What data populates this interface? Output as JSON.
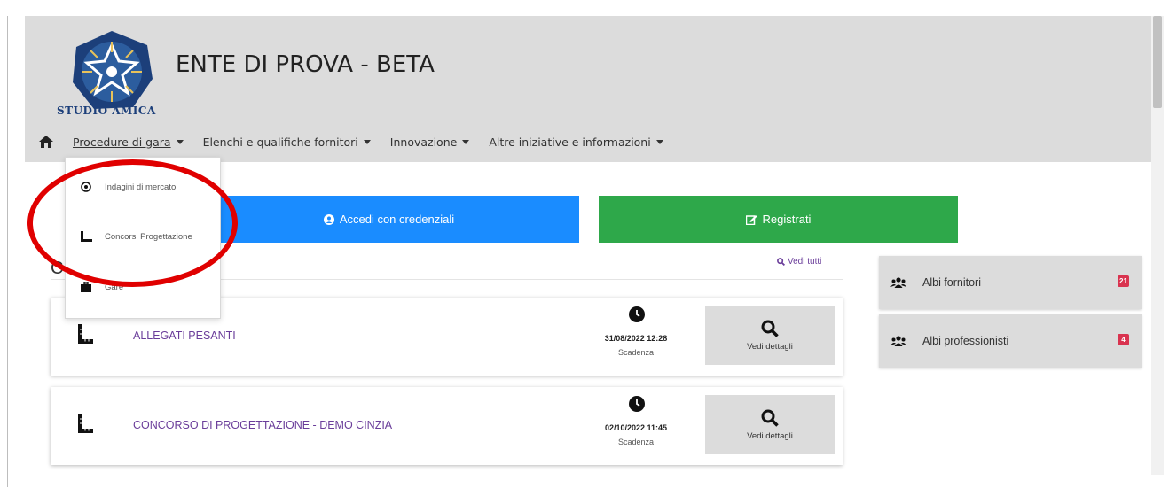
{
  "header": {
    "logo_text": "STUDIO AMICA",
    "site_title": "ENTE DI PROVA - BETA"
  },
  "nav": {
    "items": [
      {
        "label": "Procedure di gara"
      },
      {
        "label": "Elenchi e qualifiche fornitori"
      },
      {
        "label": "Innovazione"
      },
      {
        "label": "Altre iniziative e informazioni"
      }
    ]
  },
  "dropdown": {
    "items": [
      {
        "label": "Indagini di mercato",
        "icon": "target-icon"
      },
      {
        "label": "Concorsi Progettazione",
        "icon": "ruler-icon"
      },
      {
        "label": "Gare",
        "icon": "briefcase-icon"
      }
    ]
  },
  "buttons": {
    "login": "Accedi con credenziali",
    "register": "Registrati"
  },
  "section": {
    "title_partial": "Co",
    "view_all": "Vedi tutti"
  },
  "cards": [
    {
      "title": "ALLEGATI PESANTI",
      "date": "31/08/2022 12:28",
      "deadline_label": "Scadenza",
      "details_label": "Vedi dettagli"
    },
    {
      "title": "CONCORSO DI PROGETTAZIONE - DEMO CINZIA",
      "date": "02/10/2022 11:45",
      "deadline_label": "Scadenza",
      "details_label": "Vedi dettagli"
    }
  ],
  "sidebar": [
    {
      "label": "Albi fornitori",
      "badge": "21"
    },
    {
      "label": "Albi professionisti",
      "badge": "4"
    }
  ],
  "colors": {
    "header_bg": "#dcdcdc",
    "login_button": "#1a8cff",
    "register_button": "#2ea84a",
    "link_purple": "#6a3d9a",
    "badge_red": "#d9334f",
    "annotation_red": "#e00000"
  }
}
